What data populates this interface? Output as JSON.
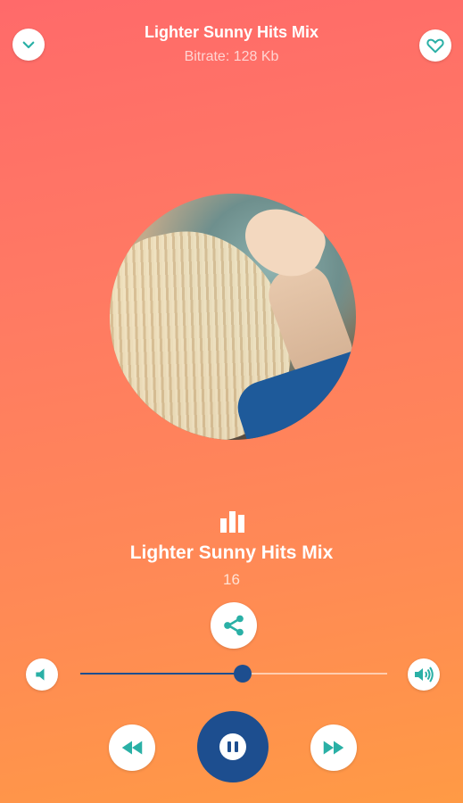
{
  "header": {
    "title": "Lighter Sunny Hits Mix",
    "subtitle": "Bitrate: 128 Kb",
    "collapse_icon": "chevron-down-icon",
    "favorite_icon": "heart-icon"
  },
  "now_playing": {
    "title": "Lighter Sunny Hits Mix",
    "number": "16",
    "art_description_icon": "album-art"
  },
  "controls": {
    "volume_level": 0.53,
    "share_icon": "share-icon",
    "volume_low_icon": "volume-low-icon",
    "volume_high_icon": "volume-high-icon",
    "rewind_icon": "rewind-icon",
    "pause_icon": "pause-icon",
    "fast_forward_icon": "fast-forward-icon",
    "state": "playing"
  },
  "colors": {
    "accent": "#1d4e8f",
    "icon": "#2ab0a6",
    "gradient_top": "#ff6a6a",
    "gradient_bottom": "#ff9a45"
  }
}
